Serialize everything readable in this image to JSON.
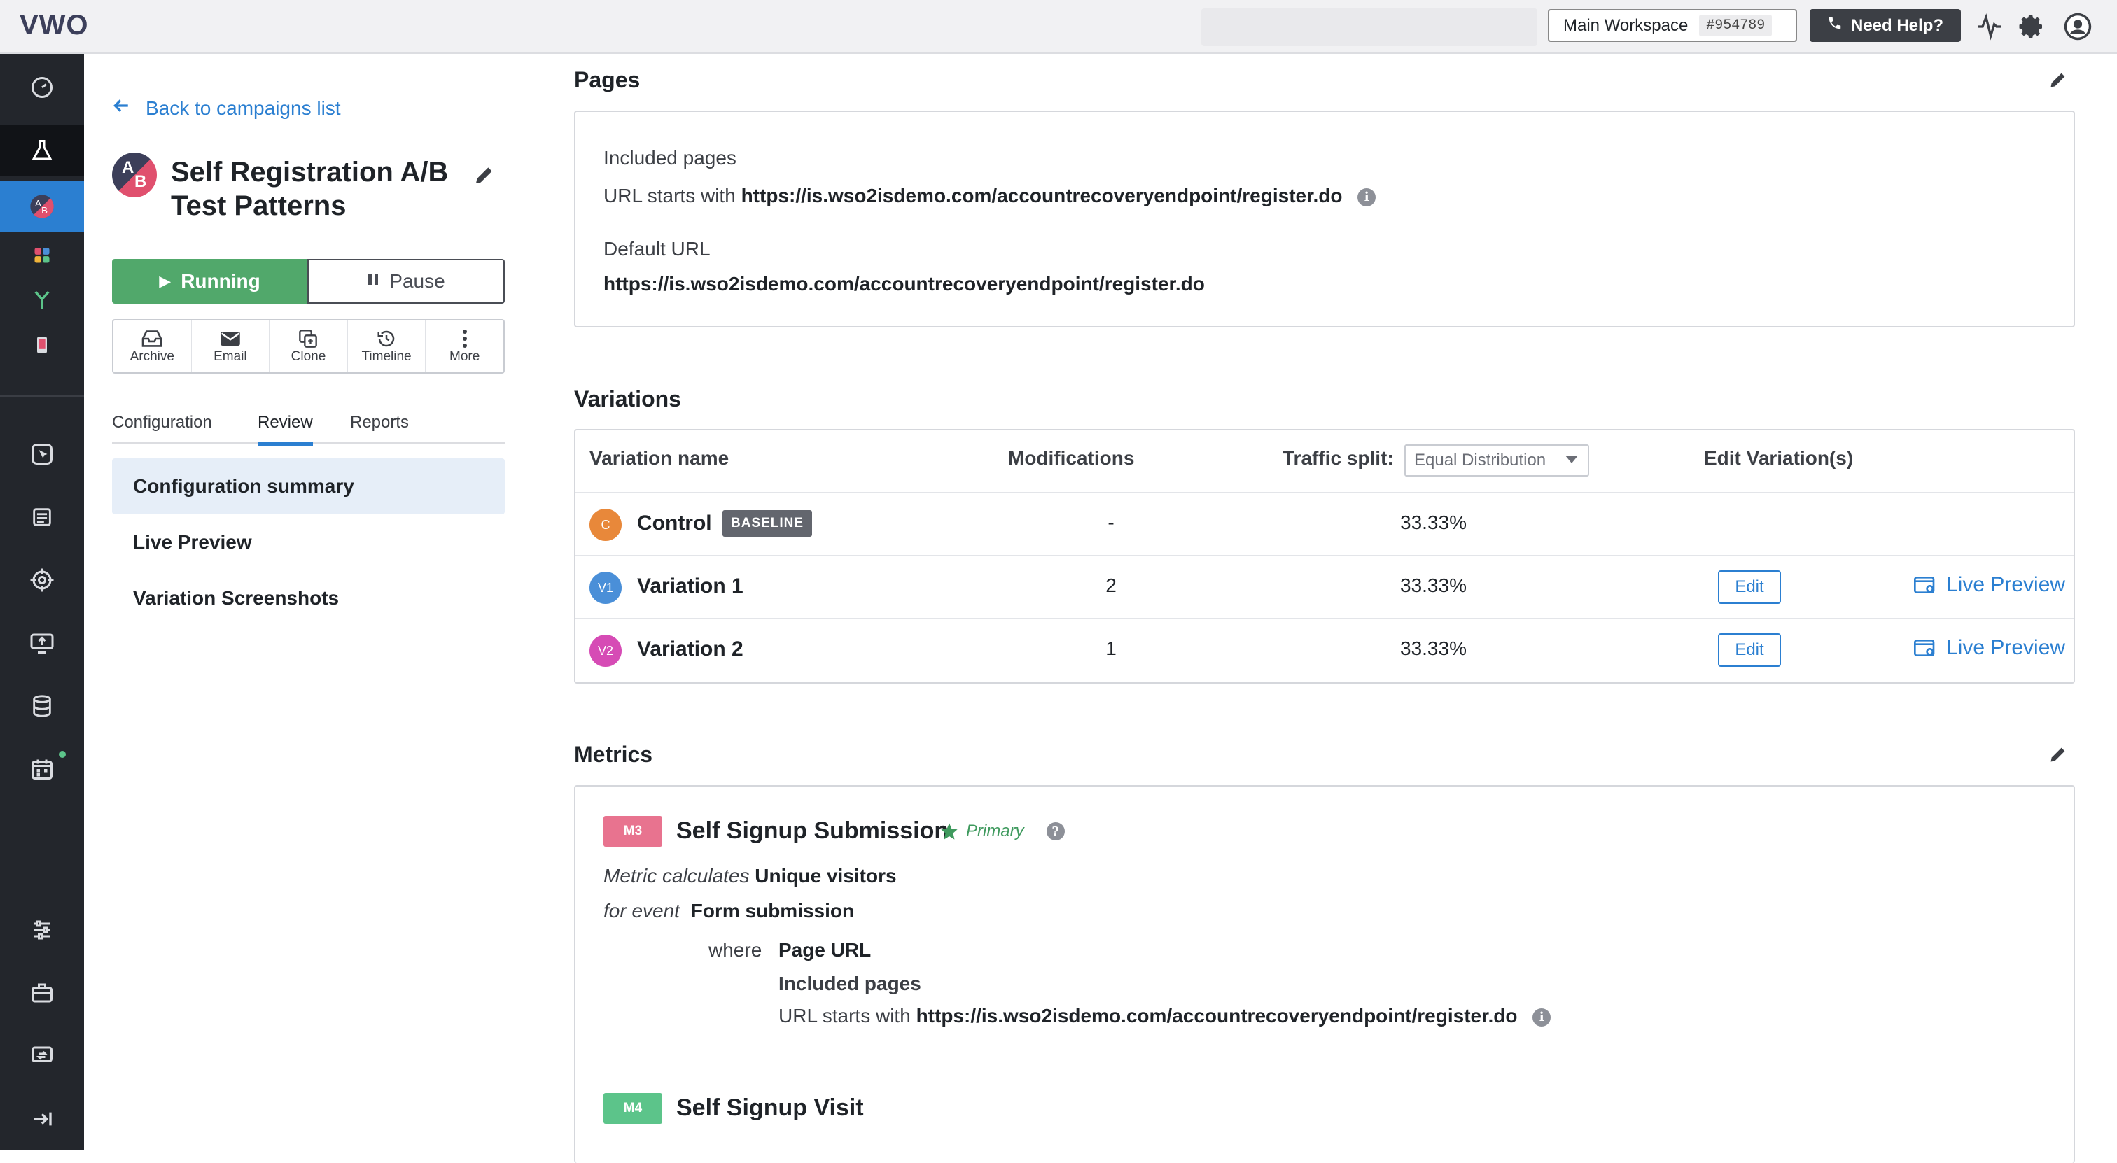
{
  "topbar": {
    "logo_text": "VWO",
    "workspace_name": "Main Workspace",
    "workspace_id": "#954789",
    "help_label": "Need Help?"
  },
  "sidebar": {
    "back_label": "Back to campaigns list",
    "campaign_avatar_a": "A",
    "campaign_avatar_b": "B",
    "campaign_title": "Self Registration A/B Test Patterns",
    "running_label": "Running",
    "pause_label": "Pause",
    "actions": [
      "Archive",
      "Email",
      "Clone",
      "Timeline",
      "More"
    ],
    "tabs": [
      "Configuration",
      "Review",
      "Reports"
    ],
    "active_tab": "Review",
    "items": [
      "Configuration summary",
      "Live Preview",
      "Variation Screenshots"
    ]
  },
  "pages": {
    "title": "Pages",
    "included_label": "Included pages",
    "url_rule_prefix": "URL starts with",
    "url_rule_value": "https://is.wso2isdemo.com/accountrecoveryendpoint/register.do",
    "default_url_label": "Default URL",
    "default_url_value": "https://is.wso2isdemo.com/accountrecoveryendpoint/register.do"
  },
  "variations": {
    "title": "Variations",
    "headers": {
      "name": "Variation name",
      "modifications": "Modifications",
      "traffic": "Traffic split:",
      "edit": "Edit Variation(s)"
    },
    "distribution": "Equal Distribution",
    "baseline_label": "BASELINE",
    "edit_label": "Edit",
    "live_preview_label": "Live Preview",
    "rows": [
      {
        "badge": "C",
        "name": "Control",
        "modifications": "-",
        "split": "33.33%",
        "color": "#e8883a"
      },
      {
        "badge": "V1",
        "name": "Variation 1",
        "modifications": "2",
        "split": "33.33%",
        "color": "#4a8fd8"
      },
      {
        "badge": "V2",
        "name": "Variation 2",
        "modifications": "1",
        "split": "33.33%",
        "color": "#d64bb5"
      }
    ]
  },
  "metrics": {
    "title": "Metrics",
    "m3": {
      "tag": "M3",
      "name": "Self Signup Submission",
      "primary": "Primary",
      "calc_label": "Metric calculates",
      "calc_value": "Unique visitors",
      "event_label": "for event",
      "event_value": "Form submission",
      "where_label": "where",
      "where_value": "Page URL",
      "included_label": "Included pages",
      "url_prefix": "URL starts with",
      "url_value": "https://is.wso2isdemo.com/accountrecoveryendpoint/register.do"
    },
    "m4": {
      "tag": "M4",
      "name": "Self Signup Visit"
    }
  },
  "colors": {
    "accent": "#2b7fd1",
    "running": "#51a86b",
    "m3_tag": "#e8738f",
    "m4_tag": "#5cc48a"
  }
}
